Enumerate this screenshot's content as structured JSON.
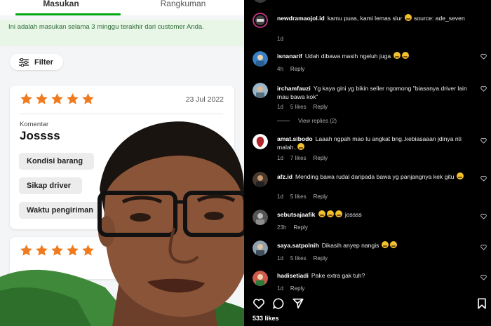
{
  "feedback_app": {
    "tabs": [
      {
        "label": "Masukan",
        "active": true
      },
      {
        "label": "Rangkuman",
        "active": false
      }
    ],
    "notice": "Ini adalah masukan selama 3 minggu terakhir dari customer Anda.",
    "filter_label": "Filter",
    "cards": [
      {
        "rating": 5,
        "date": "23 Jul 2022",
        "comment_label": "Komentar",
        "comment": "Jossss",
        "chips": [
          "Kondisi barang",
          "Sikap driver",
          "Waktu pengiriman"
        ]
      },
      {
        "rating": 5
      }
    ],
    "colors": {
      "accent": "#00aa13",
      "star": "#f07b1e"
    }
  },
  "instagram": {
    "comments": [
      {
        "user": "newdramaojol.id",
        "text": "kamu puas, kami lemas slur",
        "emoji": [
          "sad-emoji"
        ],
        "text_after": " source: ade_seven",
        "time": "1d",
        "likes": "",
        "reply": ""
      },
      {
        "user": "isnanarif",
        "text": "Udah dibawa masih ngeluh juga",
        "emoji": [
          "laugh-emoji",
          "laugh-emoji"
        ],
        "time": "4h",
        "likes": "",
        "reply": "Reply"
      },
      {
        "user": "irchamfauzi",
        "text": "Yg kaya gini yg bikin seller ngomong \"biasanya driver lain mau bawa kok\"",
        "time": "1d",
        "likes": "5 likes",
        "reply": "Reply",
        "view_replies": "View replies (2)"
      },
      {
        "user": "amat.sibodo",
        "text": "Laaah ngpah mao lu angkat bng..kebiasaaan jdinya nti malah..",
        "emoji": [
          "laugh-emoji"
        ],
        "time": "1d",
        "likes": "7 likes",
        "reply": "Reply"
      },
      {
        "user": "afz.id",
        "text": "Mending bawa rudal daripada bawa yg panjangnya kek gitu",
        "emoji": [
          "laugh-emoji"
        ],
        "time": "1d",
        "likes": "5 likes",
        "reply": "Reply"
      },
      {
        "user": "sebutsajaafik",
        "text": "",
        "emoji": [
          "laugh-emoji",
          "laugh-emoji",
          "laugh-emoji"
        ],
        "text_after": " jossss",
        "time": "23h",
        "likes": "",
        "reply": "Reply"
      },
      {
        "user": "saya.satpolnih",
        "text": "Dikasih anyep nangis",
        "emoji": [
          "laugh-emoji",
          "laugh-emoji"
        ],
        "time": "1d",
        "likes": "5 likes",
        "reply": "Reply"
      },
      {
        "user": "hadisetiadi",
        "text": "Pake extra gak tuh?",
        "time": "1d",
        "likes": "",
        "reply": "Reply"
      }
    ],
    "likes_count": "533 likes",
    "icons": [
      "heart-icon",
      "comment-icon",
      "share-icon",
      "bookmark-icon"
    ]
  }
}
